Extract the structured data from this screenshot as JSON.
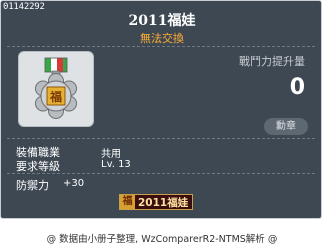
{
  "item": {
    "id": "01142292",
    "title": "2011福娃",
    "tradability": "無法交換",
    "icon_name": "medal-icon",
    "combat_power_label": "戰鬥力提升量",
    "combat_power_value": "0",
    "medal_button": "勳章",
    "job_label": "裝備職業",
    "job_value": "共用",
    "level_label": "要求等級",
    "level_value": "Lv. 13",
    "defense_label": "防禦力",
    "defense_value": "+30",
    "set_icon_char": "福",
    "set_name": "2011福娃"
  },
  "footer": {
    "text": "@ 数据由小册子整理, WzComparerR2-NTMS解析 @"
  },
  "colors": {
    "background": "#3d4852",
    "untradable": "#ffae35",
    "title": "#ffffff"
  }
}
